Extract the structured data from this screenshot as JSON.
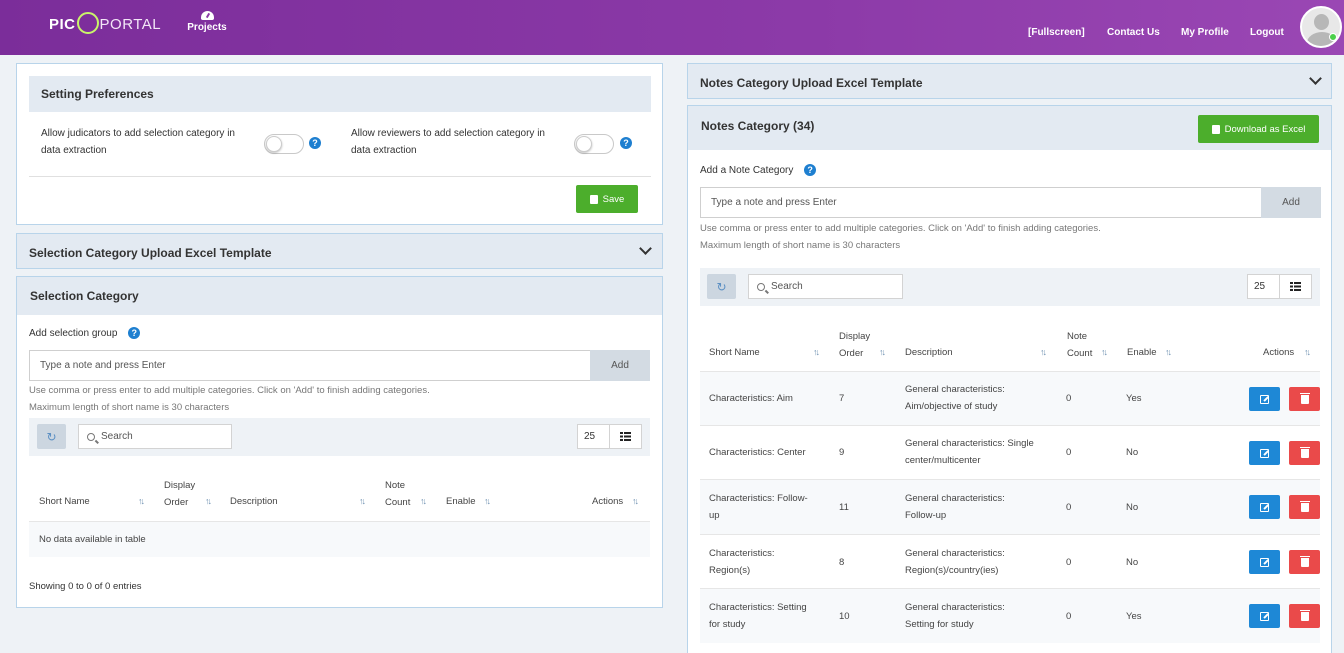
{
  "header": {
    "logo_left": "PICO",
    "logo_right": "PORTAL",
    "nav_projects": "Projects",
    "fullscreen": "[Fullscreen]",
    "contact": "Contact Us",
    "profile": "My Profile",
    "logout": "Logout"
  },
  "settings": {
    "title": "Setting Preferences",
    "judicators_label_1": "Allow judicators to add selection category in",
    "judicators_label_2": "data extraction",
    "reviewers_label_1": "Allow reviewers to add selection category in",
    "reviewers_label_2": "data extraction",
    "judicators_enabled": false,
    "reviewers_enabled": false,
    "save_label": "Save"
  },
  "selection_upload": {
    "title": "Selection Category Upload Excel Template"
  },
  "selection_category": {
    "title": "Selection Category",
    "add_label": "Add selection group",
    "input_placeholder": "Type a note and press Enter",
    "add_button": "Add",
    "hint_1": "Use comma or press enter to add multiple categories. Click on 'Add' to finish adding categories.",
    "hint_2": "Maximum length of short name is 30 characters",
    "search_placeholder": "Search",
    "page_size": "25",
    "columns": {
      "short_name": "Short Name",
      "display_1": "Display",
      "display_2": "Order",
      "description": "Description",
      "note_1": "Note",
      "note_2": "Count",
      "enable": "Enable",
      "actions": "Actions"
    },
    "empty": "No data available in table",
    "footer": "Showing 0 to 0 of 0 entries"
  },
  "notes_upload": {
    "title": "Notes Category Upload Excel Template"
  },
  "notes_category": {
    "title": "Notes Category (34)",
    "download_label": "Download as Excel",
    "add_label": "Add a Note Category",
    "input_placeholder": "Type a note and press Enter",
    "add_button": "Add",
    "hint_1": "Use comma or press enter to add multiple categories. Click on 'Add' to finish adding categories.",
    "hint_2": "Maximum length of short name is 30 characters",
    "search_placeholder": "Search",
    "page_size": "25",
    "columns": {
      "short_name": "Short Name",
      "display_1": "Display",
      "display_2": "Order",
      "description": "Description",
      "note_1": "Note",
      "note_2": "Count",
      "enable": "Enable",
      "actions": "Actions"
    },
    "rows": [
      {
        "name_1": "Characteristics: Aim",
        "name_2": "",
        "order": "7",
        "desc_1": "General characteristics:",
        "desc_2": "Aim/objective of study",
        "count": "0",
        "enable": "Yes"
      },
      {
        "name_1": "Characteristics: Center",
        "name_2": "",
        "order": "9",
        "desc_1": "General characteristics: Single",
        "desc_2": "center/multicenter",
        "count": "0",
        "enable": "No"
      },
      {
        "name_1": "Characteristics: Follow-",
        "name_2": "up",
        "order": "11",
        "desc_1": "General characteristics:",
        "desc_2": "Follow-up",
        "count": "0",
        "enable": "No"
      },
      {
        "name_1": "Characteristics:",
        "name_2": "Region(s)",
        "order": "8",
        "desc_1": "General characteristics:",
        "desc_2": "Region(s)/country(ies)",
        "count": "0",
        "enable": "No"
      },
      {
        "name_1": "Characteristics: Setting",
        "name_2": "for study",
        "order": "10",
        "desc_1": "General characteristics:",
        "desc_2": "Setting for study",
        "count": "0",
        "enable": "Yes"
      }
    ]
  }
}
